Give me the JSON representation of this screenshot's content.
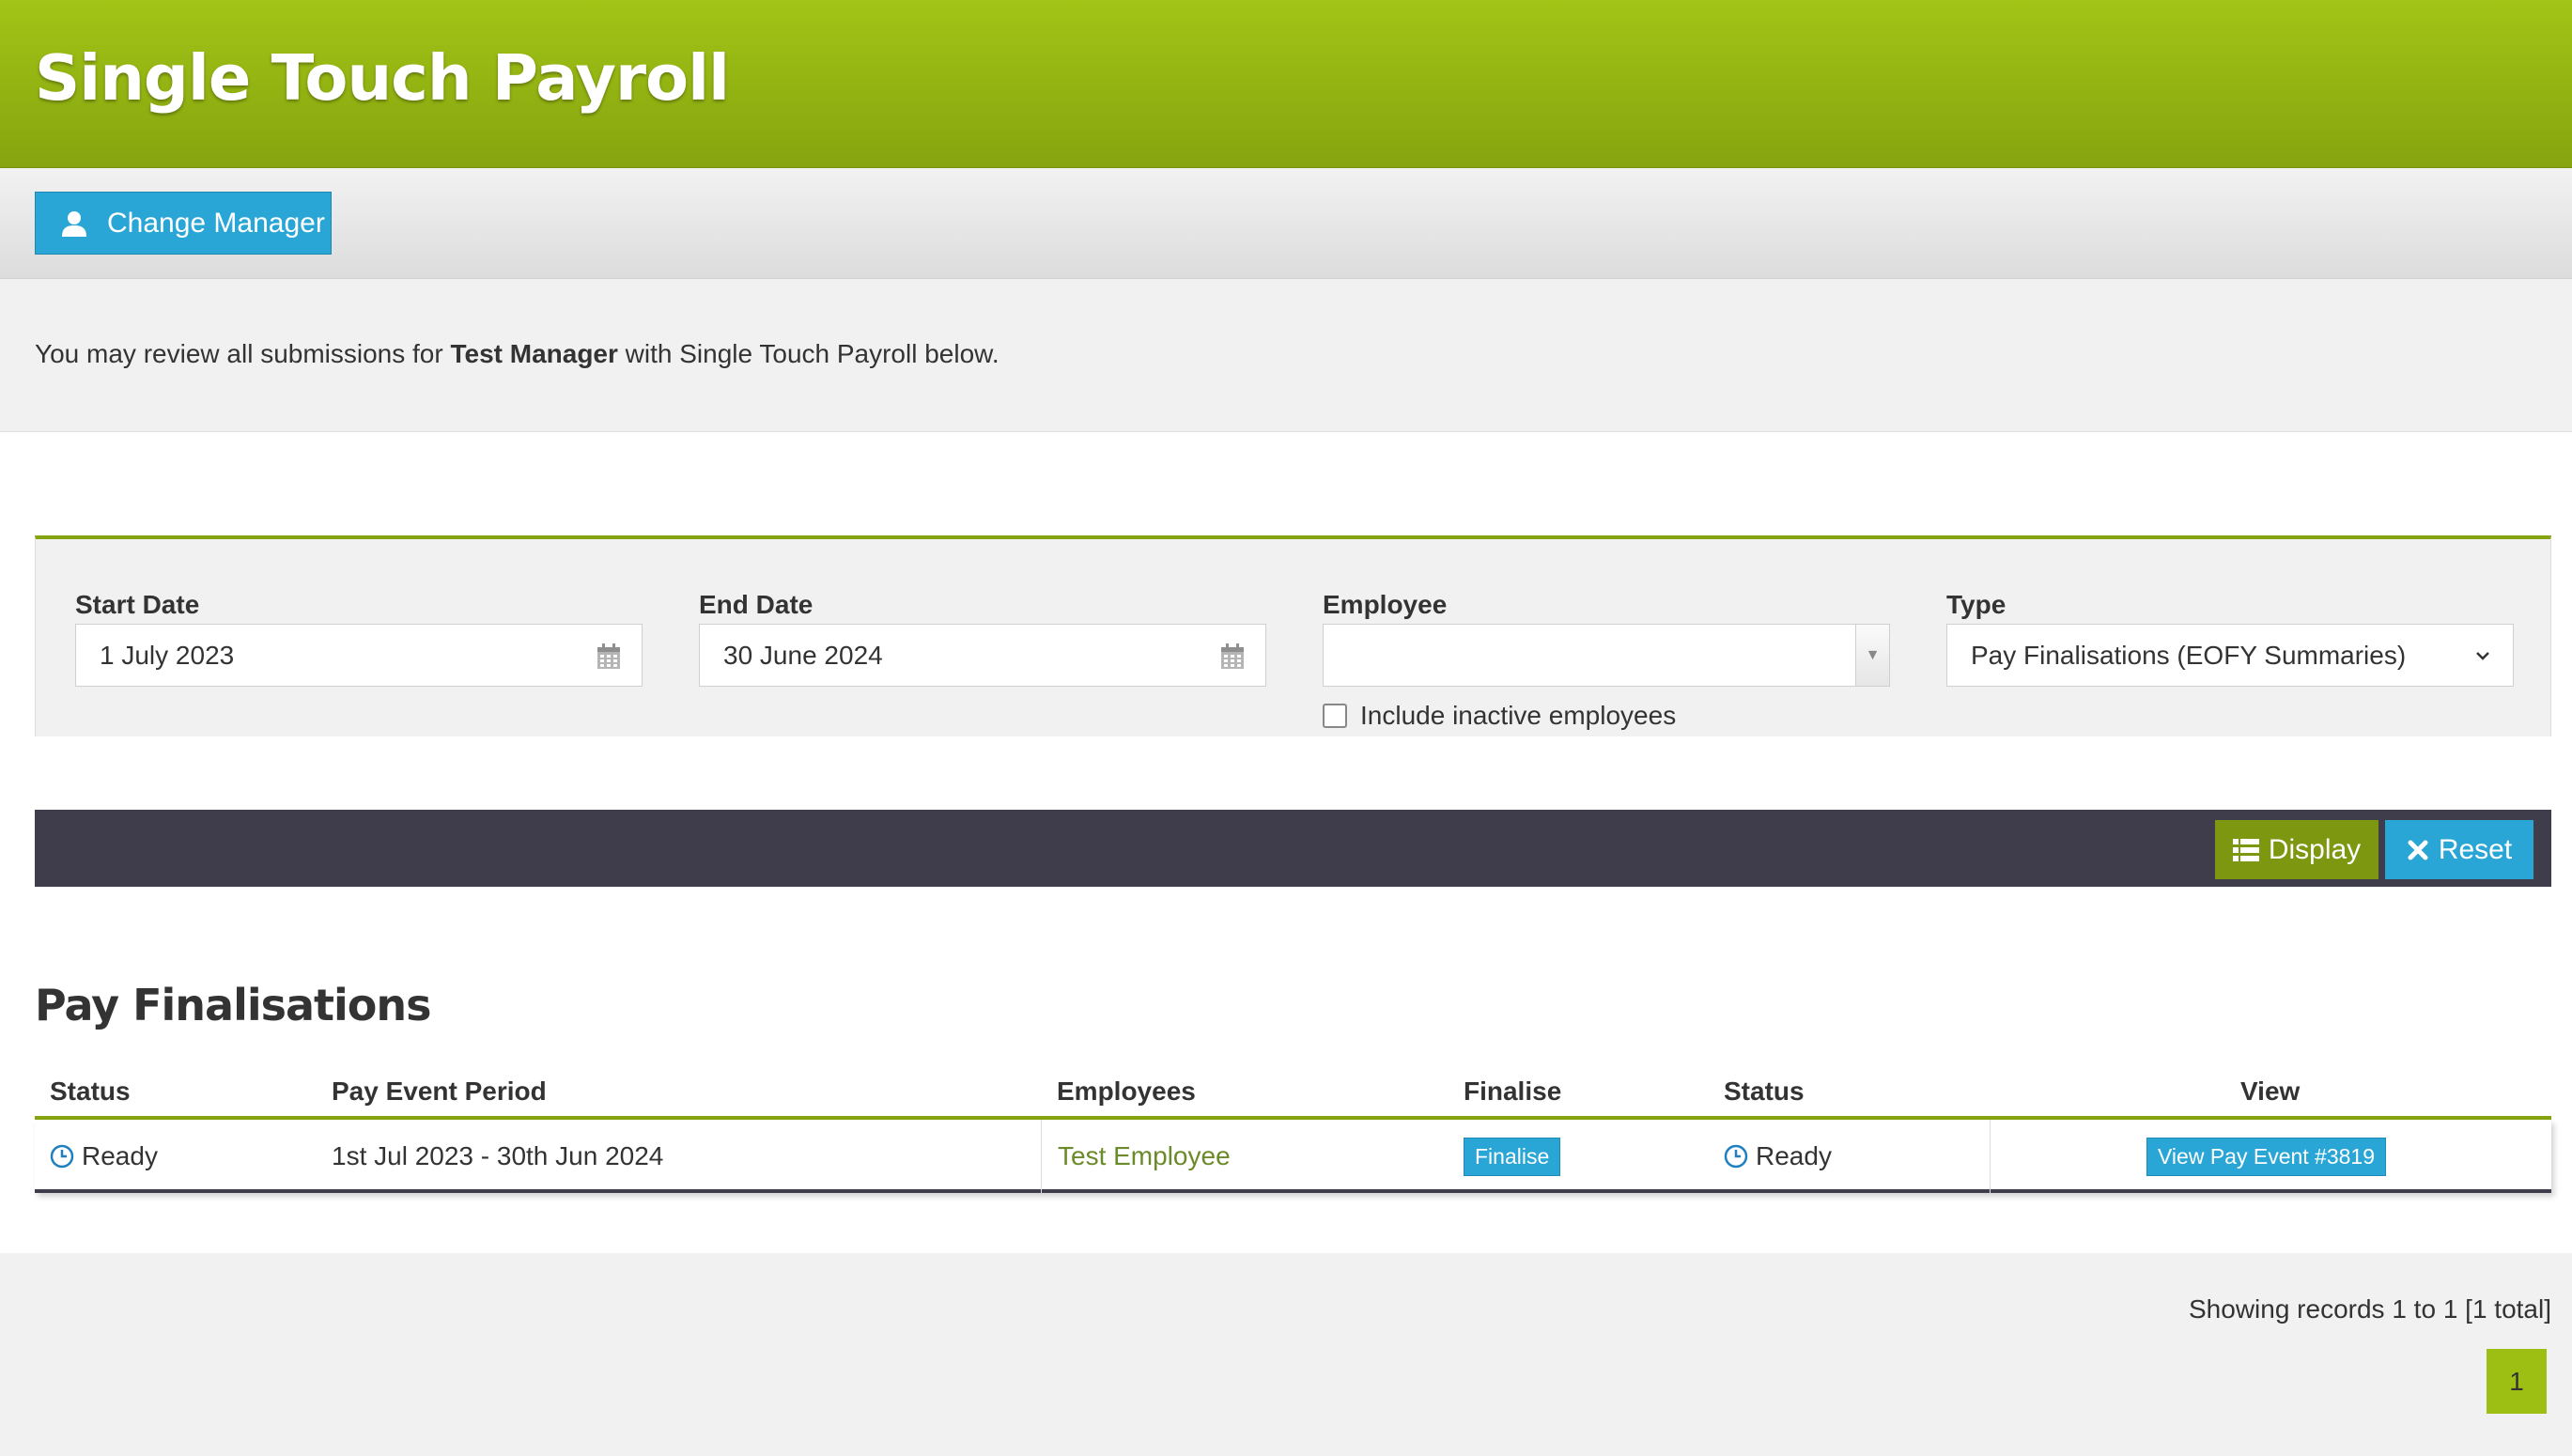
{
  "header": {
    "title": "Single Touch Payroll"
  },
  "toolbar": {
    "change_manager_label": "Change Manager"
  },
  "info": {
    "prefix": "You may review all submissions for ",
    "manager": "Test Manager",
    "suffix": " with Single Touch Payroll below."
  },
  "filters": {
    "start_date_label": "Start Date",
    "start_date_value": "1 July 2023",
    "end_date_label": "End Date",
    "end_date_value": "30 June 2024",
    "employee_label": "Employee",
    "employee_value": "",
    "include_inactive_label": "Include inactive employees",
    "include_inactive_checked": false,
    "type_label": "Type",
    "type_value": "Pay Finalisations (EOFY Summaries)",
    "display_label": "Display",
    "reset_label": "Reset"
  },
  "section": {
    "title": "Pay Finalisations"
  },
  "table": {
    "headers": [
      "Status",
      "Pay Event Period",
      "Employees",
      "Finalise",
      "Status",
      "View"
    ],
    "rows": [
      {
        "status": "Ready",
        "period": "1st Jul 2023 - 30th Jun 2024",
        "employee": "Test Employee",
        "finalise_label": "Finalise",
        "status2": "Ready",
        "view_label": "View Pay Event #3819"
      }
    ]
  },
  "pagination": {
    "summary": "Showing records 1 to 1 [1 total]",
    "current_page": "1"
  },
  "colors": {
    "header_green": "#9dbf13",
    "accent_blue": "#2aa6d6",
    "dark_bar": "#3f3d4c",
    "display_green": "#7d9710"
  }
}
